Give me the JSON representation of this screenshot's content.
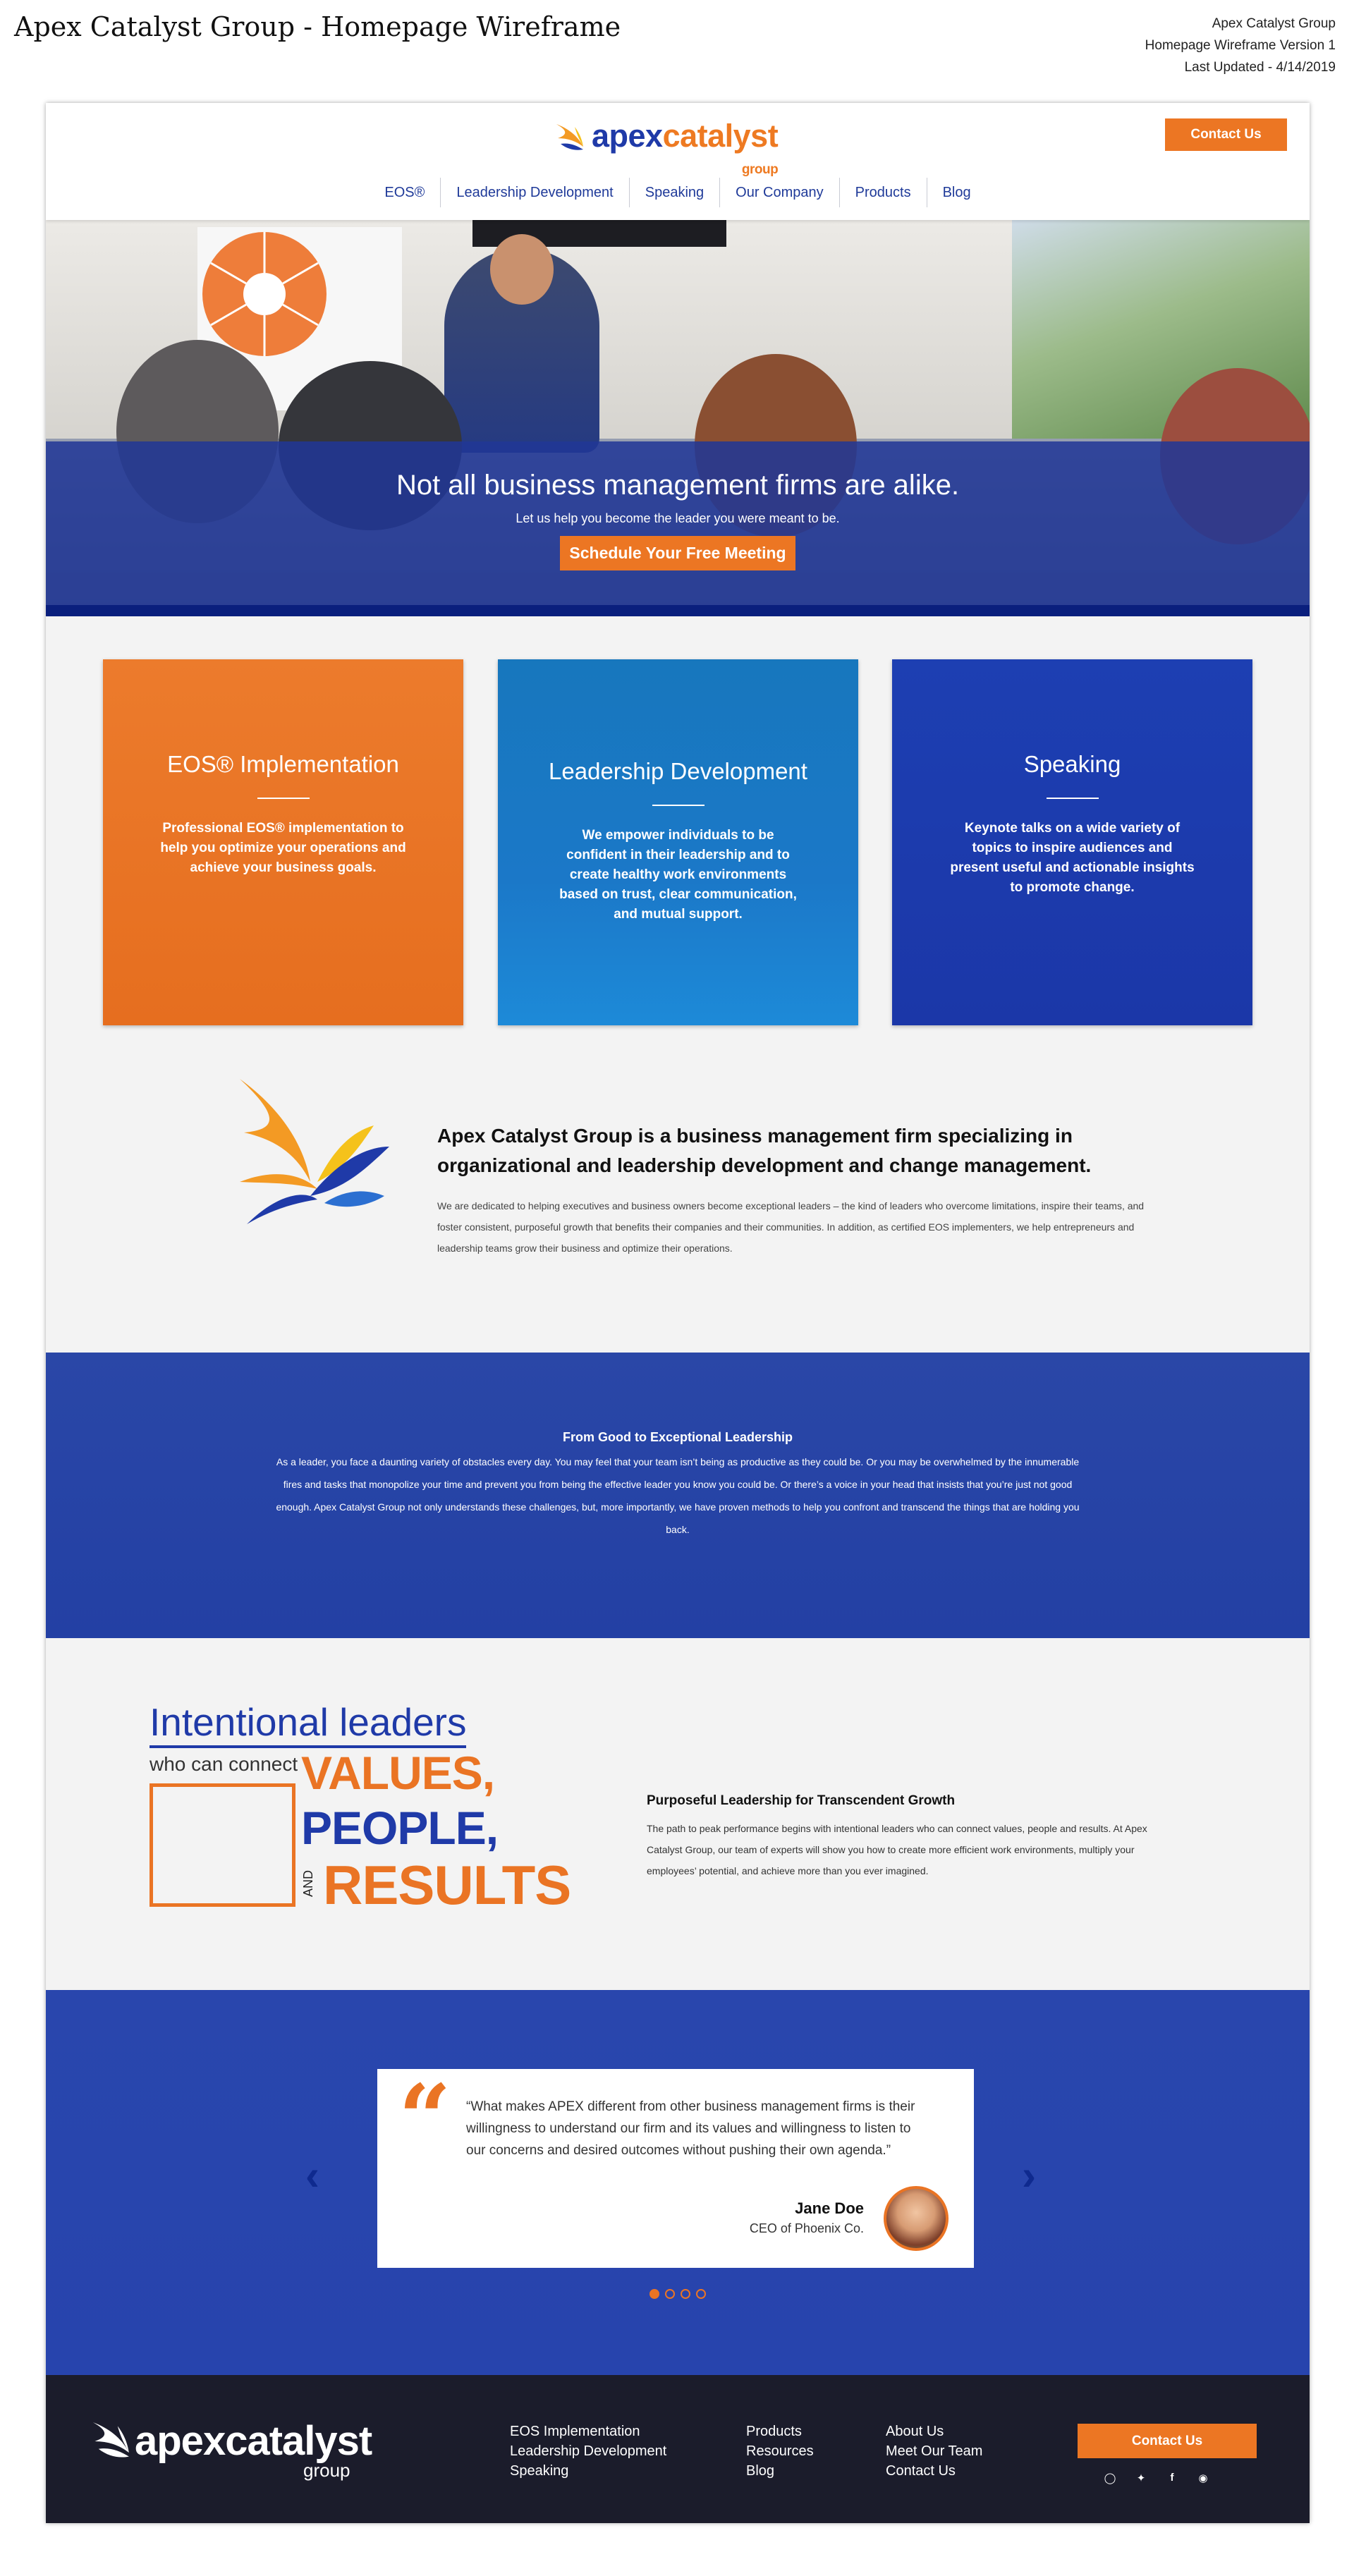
{
  "doc": {
    "title": "Apex Catalyst Group - Homepage Wireframe",
    "meta_company": "Apex Catalyst Group",
    "meta_version": "Homepage Wireframe Version 1",
    "meta_updated": "Last Updated - 4/14/2019"
  },
  "brand": {
    "word_apex": "apex",
    "word_catalyst": "catalyst",
    "word_group": "group",
    "footer_word": "apexcatalyst",
    "colors": {
      "orange": "#EC7623",
      "blue": "#1F3AA8",
      "navy": "#1B1C2B"
    }
  },
  "nav": {
    "contact_label": "Contact Us",
    "items": [
      "EOS®",
      "Leadership Development",
      "Speaking",
      "Our Company",
      "Products",
      "Blog"
    ]
  },
  "hero": {
    "headline": "Not all business management firms are alike.",
    "subline": "Let us help you become the leader you were meant to be.",
    "cta": "Schedule Your Free Meeting"
  },
  "cards": [
    {
      "title": "EOS® Implementation",
      "body": "Professional EOS® implementation to help you optimize your operations and achieve your business goals."
    },
    {
      "title": "Leadership Development",
      "body": "We empower individuals to be confident in their leadership and to create healthy work environments based on trust, clear communication, and mutual support."
    },
    {
      "title": "Speaking",
      "body": "Keynote talks on a wide variety of topics to inspire audiences and present useful and actionable insights to promote change."
    }
  ],
  "about": {
    "heading": "Apex Catalyst Group is a business management firm specializing in organizational and leadership development and change management.",
    "body": "We are dedicated to helping executives and business owners become exceptional leaders – the kind of leaders who overcome limitations, inspire their teams, and foster consistent, purposeful growth that benefits their companies and their communities. In addition, as certified EOS implementers, we help entrepreneurs and leadership teams grow their business and optimize their operations."
  },
  "good": {
    "heading": "From Good to Exceptional Leadership",
    "body": "As a leader, you face a daunting variety of obstacles every day. You may feel that your team isn’t being as productive as they could be. Or you may be overwhelmed by the innumerable fires and tasks that monopolize your time and prevent you from being the effective leader you know you could be. Or there’s a voice in your head that insists that you’re just not good enough. Apex Catalyst Group not only understands these challenges, but, more importantly, we have proven methods to help you confront and transcend the things that are holding you back."
  },
  "intentional": {
    "title": "Intentional leaders",
    "sub": "who can connect",
    "values": "VALUES,",
    "people": "PEOPLE,",
    "and": "AND",
    "results": "RESULTS",
    "pl_heading": "Purposeful Leadership for Transcendent Growth",
    "pl_body": "The path to peak performance begins with intentional leaders who can connect values, people and results. At Apex Catalyst Group, our team of experts will show you how to create more efficient work environments, multiply your employees’ potential, and achieve more than you ever imagined."
  },
  "testimonial": {
    "quote": "“What makes APEX different from other business management firms is their willingness to understand our firm and its values and willingness to listen to our concerns and desired outcomes without pushing their own agenda.”",
    "name": "Jane Doe",
    "role": "CEO of Phoenix Co.",
    "slides": 4,
    "active_slide": 1
  },
  "footer": {
    "col1": [
      "EOS Implementation",
      "Leadership Development",
      "Speaking"
    ],
    "col2": [
      "Products",
      "Resources",
      "Blog"
    ],
    "col3": [
      "About Us",
      "Meet Our Team",
      "Contact Us"
    ],
    "contact_label": "Contact Us",
    "social": [
      "instagram-icon",
      "twitter-icon",
      "facebook-icon",
      "web-icon"
    ]
  }
}
